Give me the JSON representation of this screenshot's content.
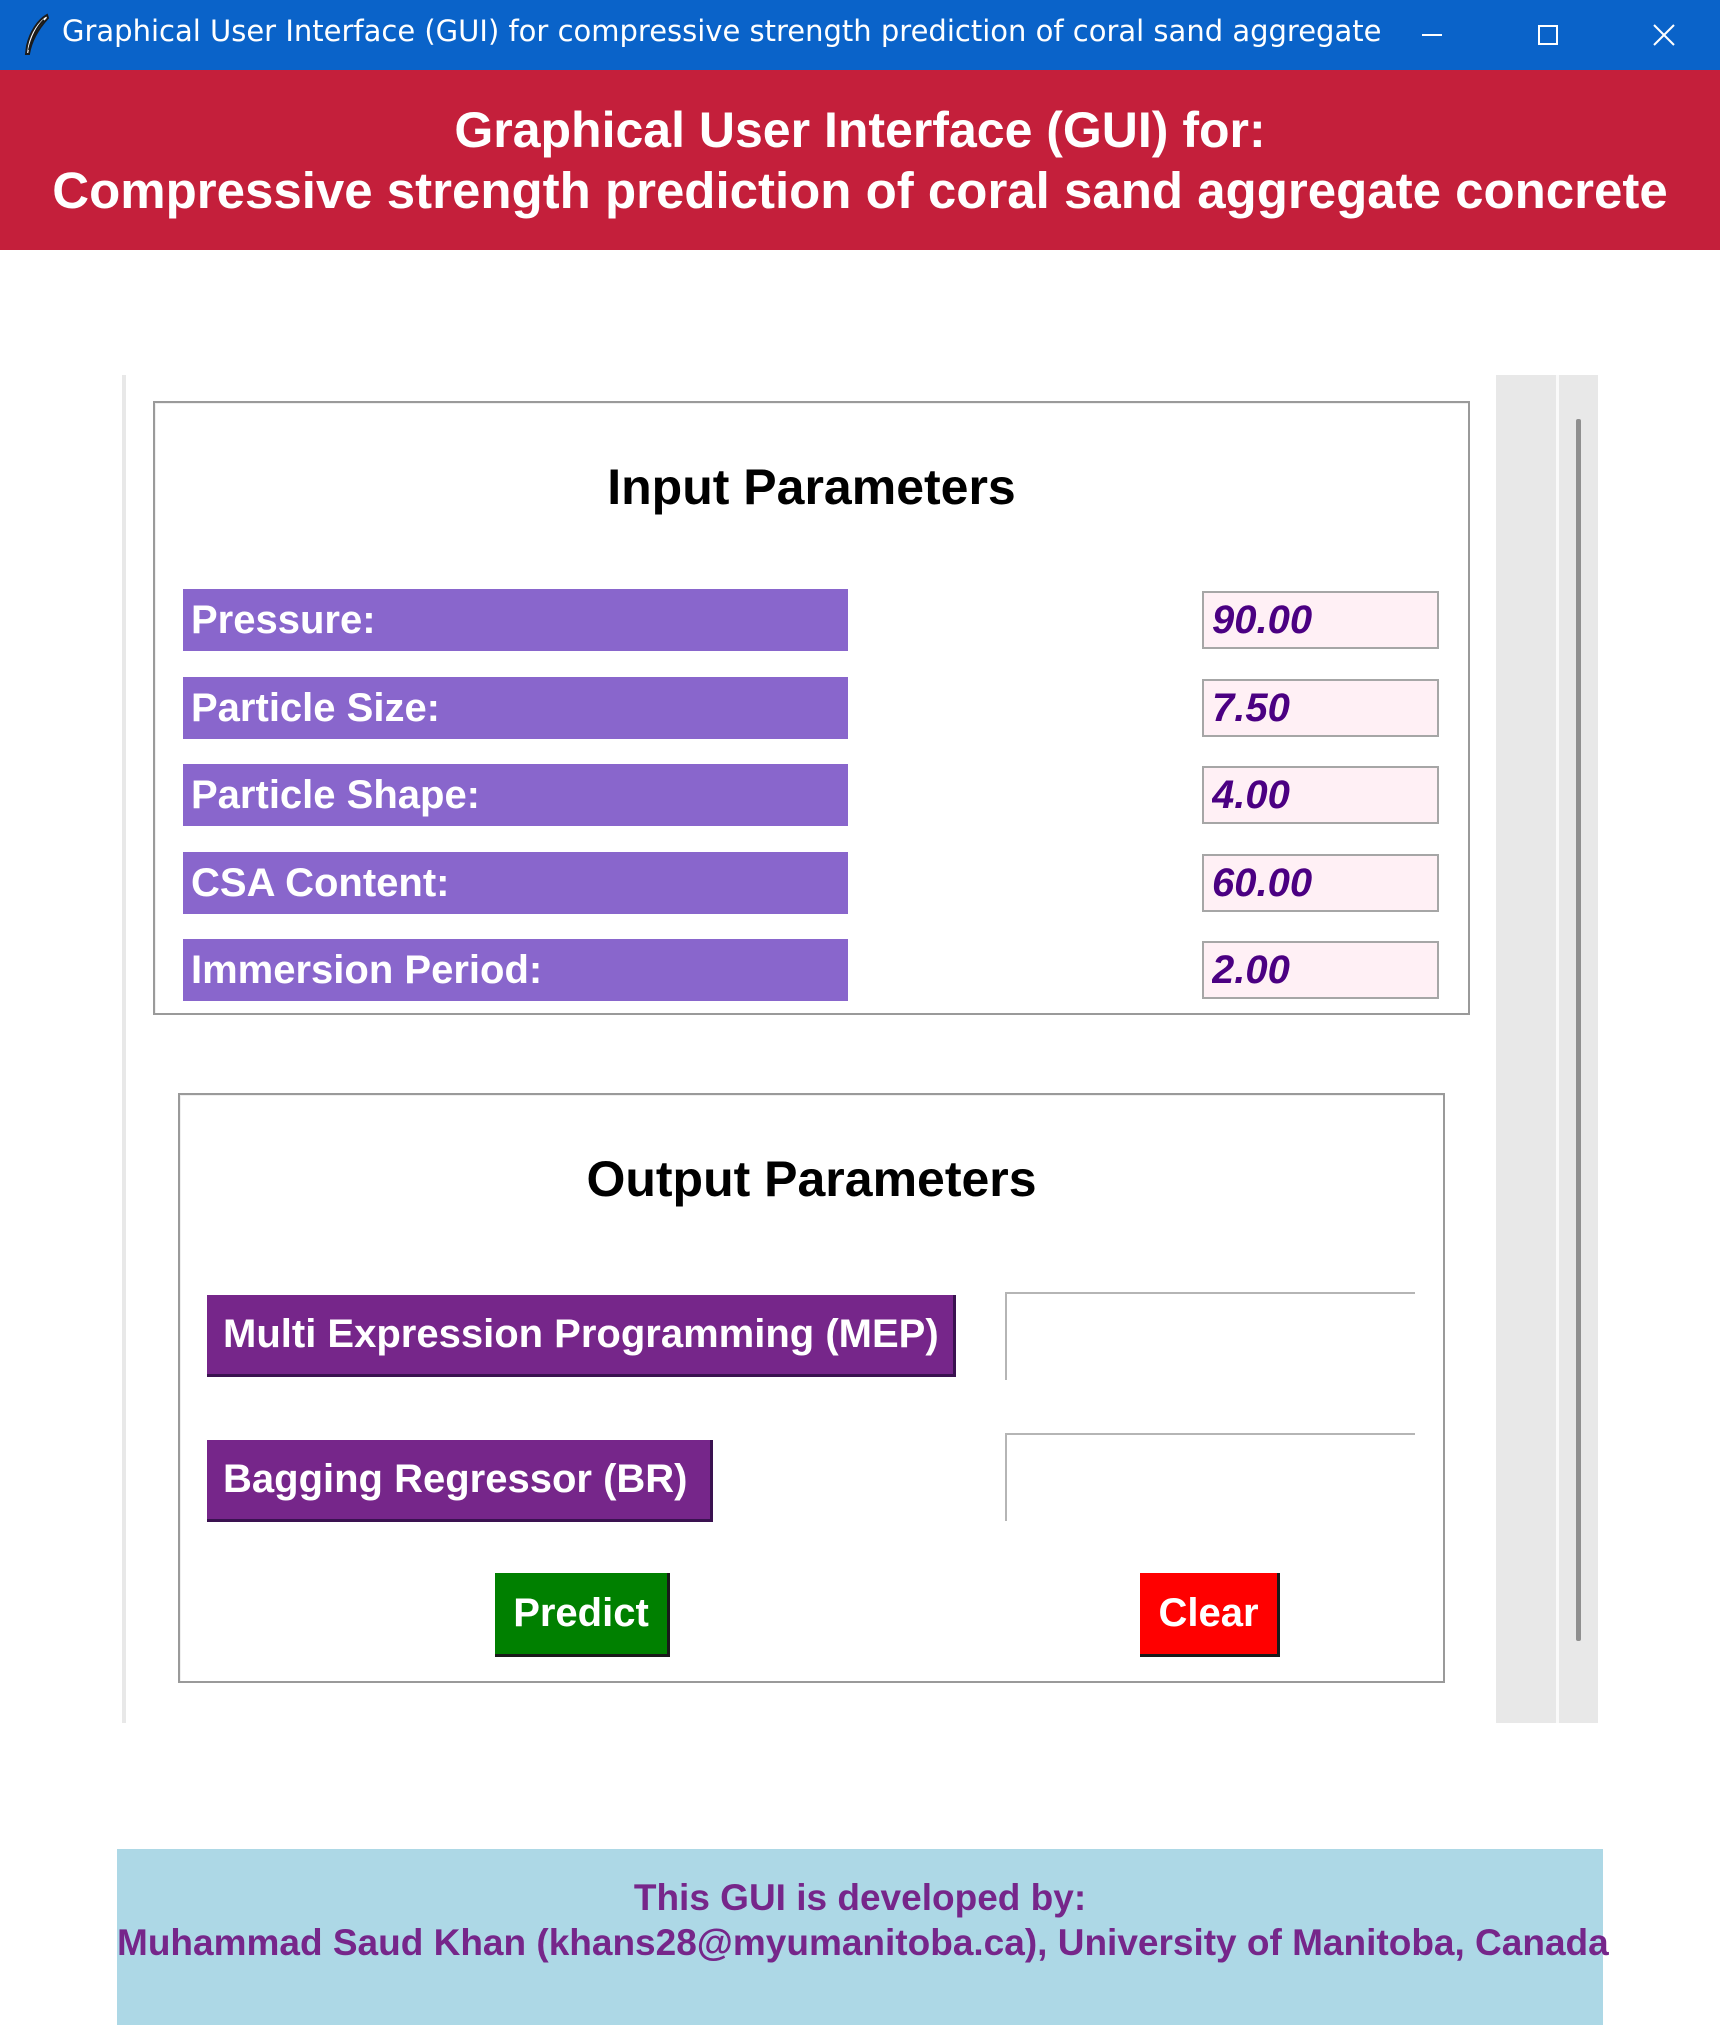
{
  "window": {
    "title": "Graphical User Interface (GUI) for compressive strength prediction of coral sand aggregate concr...",
    "icon": "feather-icon",
    "controls": [
      "minimize-icon",
      "maximize-icon",
      "close-icon"
    ]
  },
  "header": {
    "line1": "Graphical User Interface (GUI) for:",
    "line2": "Compressive strength prediction of coral sand aggregate concrete",
    "background": "#c41f3b"
  },
  "input_panel": {
    "title": "Input Parameters",
    "label_color": "#8966cc",
    "fields": [
      {
        "label": "Pressure:",
        "value": "90.00"
      },
      {
        "label": "Particle Size:",
        "value": "7.50"
      },
      {
        "label": "Particle Shape:",
        "value": "4.00"
      },
      {
        "label": "CSA Content:",
        "value": "60.00"
      },
      {
        "label": "Immersion Period:",
        "value": "2.00"
      }
    ]
  },
  "output_panel": {
    "title": "Output Parameters",
    "models": [
      {
        "label": "Multi Expression Programming (MEP)",
        "value": ""
      },
      {
        "label": "Bagging Regressor (BR)",
        "value": ""
      }
    ],
    "predict_label": "Predict",
    "clear_label": "Clear",
    "predict_color": "#008000",
    "clear_color": "#ff0000"
  },
  "footer": {
    "line1": "This GUI is developed by:",
    "line2": "Muhammad Saud Khan (khans28@myumanitoba.ca), University of Manitoba, Canada",
    "background": "#add8e6"
  }
}
